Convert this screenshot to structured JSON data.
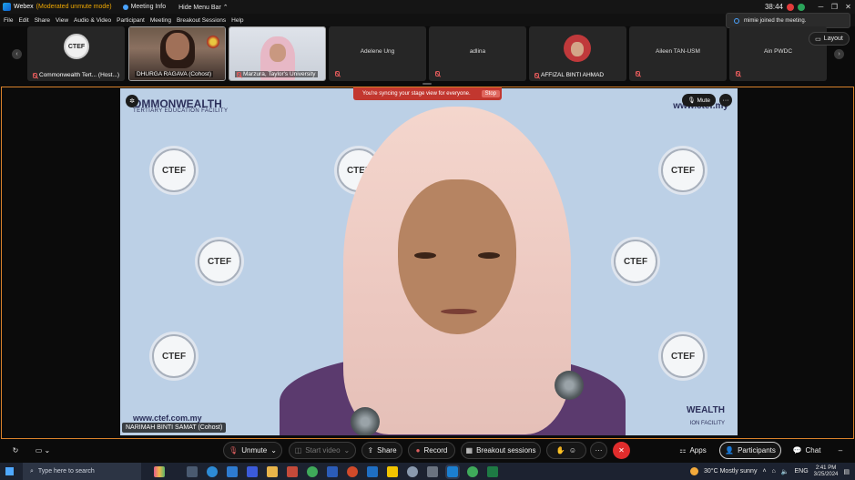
{
  "titlebar": {
    "app": "Webex",
    "mode": "(Moderated unmute mode)",
    "meeting_info": "Meeting Info",
    "hide_menu": "Hide Menu Bar",
    "time": "38:44",
    "min": "─",
    "max": "❐",
    "close": "✕"
  },
  "menu": [
    "File",
    "Edit",
    "Share",
    "View",
    "Audio & Video",
    "Participant",
    "Meeting",
    "Breakout Sessions",
    "Help"
  ],
  "toast": {
    "text": "mimie joined the meeting."
  },
  "layout_label": "Layout",
  "participants": [
    {
      "name": "Commonwealth Tert... (Host...)",
      "logo": "CTEF"
    },
    {
      "name": "DHURGA RAGAVA (Cohost)"
    },
    {
      "name": "Marzura, Taylor's University"
    },
    {
      "name": "Adelene Ung"
    },
    {
      "name": "adlina"
    },
    {
      "name": "AFFIZAL BINTI AHMAD"
    },
    {
      "name": "Aileen TAN-USM"
    },
    {
      "name": "Ain PWDC"
    }
  ],
  "stage": {
    "sync_text": "You're syncing your stage view for everyone.",
    "stop": "Stop",
    "mute": "Mute",
    "more": "···",
    "speaker_name": "NARIMAH BINTI SAMAT (Cohost)",
    "bg_title": "OMMONWEALTH",
    "bg_subtitle": "TERTIARY EDUCATION FACILITY",
    "bg_url_top": "www.ctef.my",
    "bg_url_bottom": "www.ctef.com.my",
    "bg_corner_title": "WEALTH",
    "bg_corner_sub": "ION FACILITY",
    "seal": "CTEF"
  },
  "controls": {
    "unmute": "Unmute",
    "start_video": "Start video",
    "share": "Share",
    "record": "Record",
    "breakout": "Breakout sessions",
    "apps": "Apps",
    "participants": "Participants",
    "chat": "Chat",
    "more": "···"
  },
  "taskbar": {
    "search_placeholder": "Type here to search",
    "weather": "30°C  Mostly sunny",
    "lang": "ENG",
    "time": "2:41 PM",
    "date": "3/25/2024"
  },
  "colors": {
    "stage_border": "#d9822b",
    "sync_bar": "#c2372f",
    "end_button": "#e02c2c",
    "mode_text": "#f0a800"
  }
}
